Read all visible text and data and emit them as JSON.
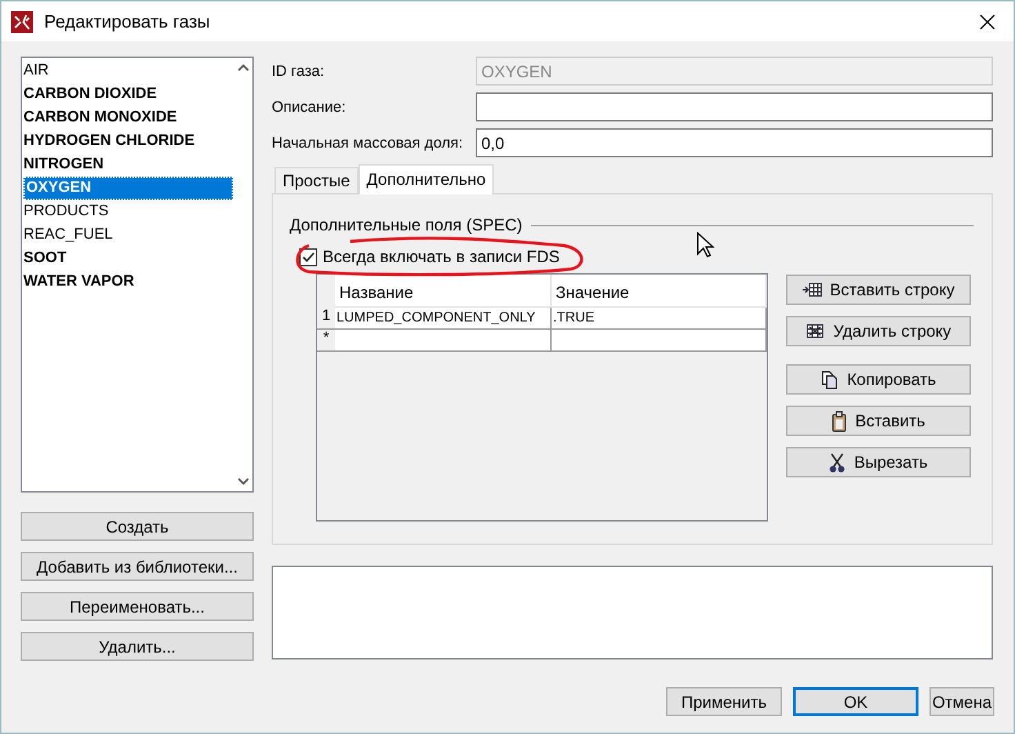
{
  "window": {
    "title": "Редактировать газы"
  },
  "gas_list": {
    "items": [
      {
        "label": "AIR",
        "emphasized": false,
        "selected": false
      },
      {
        "label": "CARBON DIOXIDE",
        "emphasized": true,
        "selected": false
      },
      {
        "label": "CARBON MONOXIDE",
        "emphasized": true,
        "selected": false
      },
      {
        "label": "HYDROGEN CHLORIDE",
        "emphasized": true,
        "selected": false
      },
      {
        "label": "NITROGEN",
        "emphasized": true,
        "selected": false
      },
      {
        "label": "OXYGEN",
        "emphasized": true,
        "selected": true
      },
      {
        "label": "PRODUCTS",
        "emphasized": false,
        "selected": false
      },
      {
        "label": "REAC_FUEL",
        "emphasized": false,
        "selected": false
      },
      {
        "label": "SOOT",
        "emphasized": true,
        "selected": false
      },
      {
        "label": "WATER VAPOR",
        "emphasized": true,
        "selected": false
      }
    ]
  },
  "list_buttons": [
    "Создать",
    "Добавить из библиотеки...",
    "Переименовать...",
    "Удалить..."
  ],
  "fields": [
    {
      "label": "ID газа:",
      "value": "OXYGEN",
      "disabled": true
    },
    {
      "label": "Описание:",
      "disabled": false
    },
    {
      "label": "Начальная массовая доля:",
      "value": "0,0",
      "disabled": false
    }
  ],
  "tabs": [
    {
      "label": "Простые",
      "selected": false
    },
    {
      "label": "Дополнительно",
      "selected": true
    }
  ],
  "spec_group": {
    "title": "Дополнительные поля (SPEC)",
    "checkbox": {
      "label": "Всегда включать в записи FDS",
      "checked": true
    },
    "table": {
      "columns": [
        "Название",
        "Значение"
      ],
      "rows": [
        {
          "index": "1",
          "cells": [
            "LUMPED_COMPONENT_ONLY",
            ".TRUE"
          ]
        },
        {
          "index": "*",
          "cells": [
            "",
            ""
          ]
        }
      ]
    },
    "buttons": [
      {
        "kind": "insert",
        "label": "Вставить строку"
      },
      {
        "kind": "delete",
        "label": "Удалить строку"
      },
      {
        "kind": "copy",
        "label": "Копировать"
      },
      {
        "kind": "paste",
        "label": "Вставить"
      },
      {
        "kind": "cut",
        "label": "Вырезать"
      }
    ]
  },
  "dialog_buttons": [
    {
      "label": "Применить",
      "default": false
    },
    {
      "label": "OK",
      "default": true
    },
    {
      "label": "Отмена",
      "default": false
    }
  ]
}
